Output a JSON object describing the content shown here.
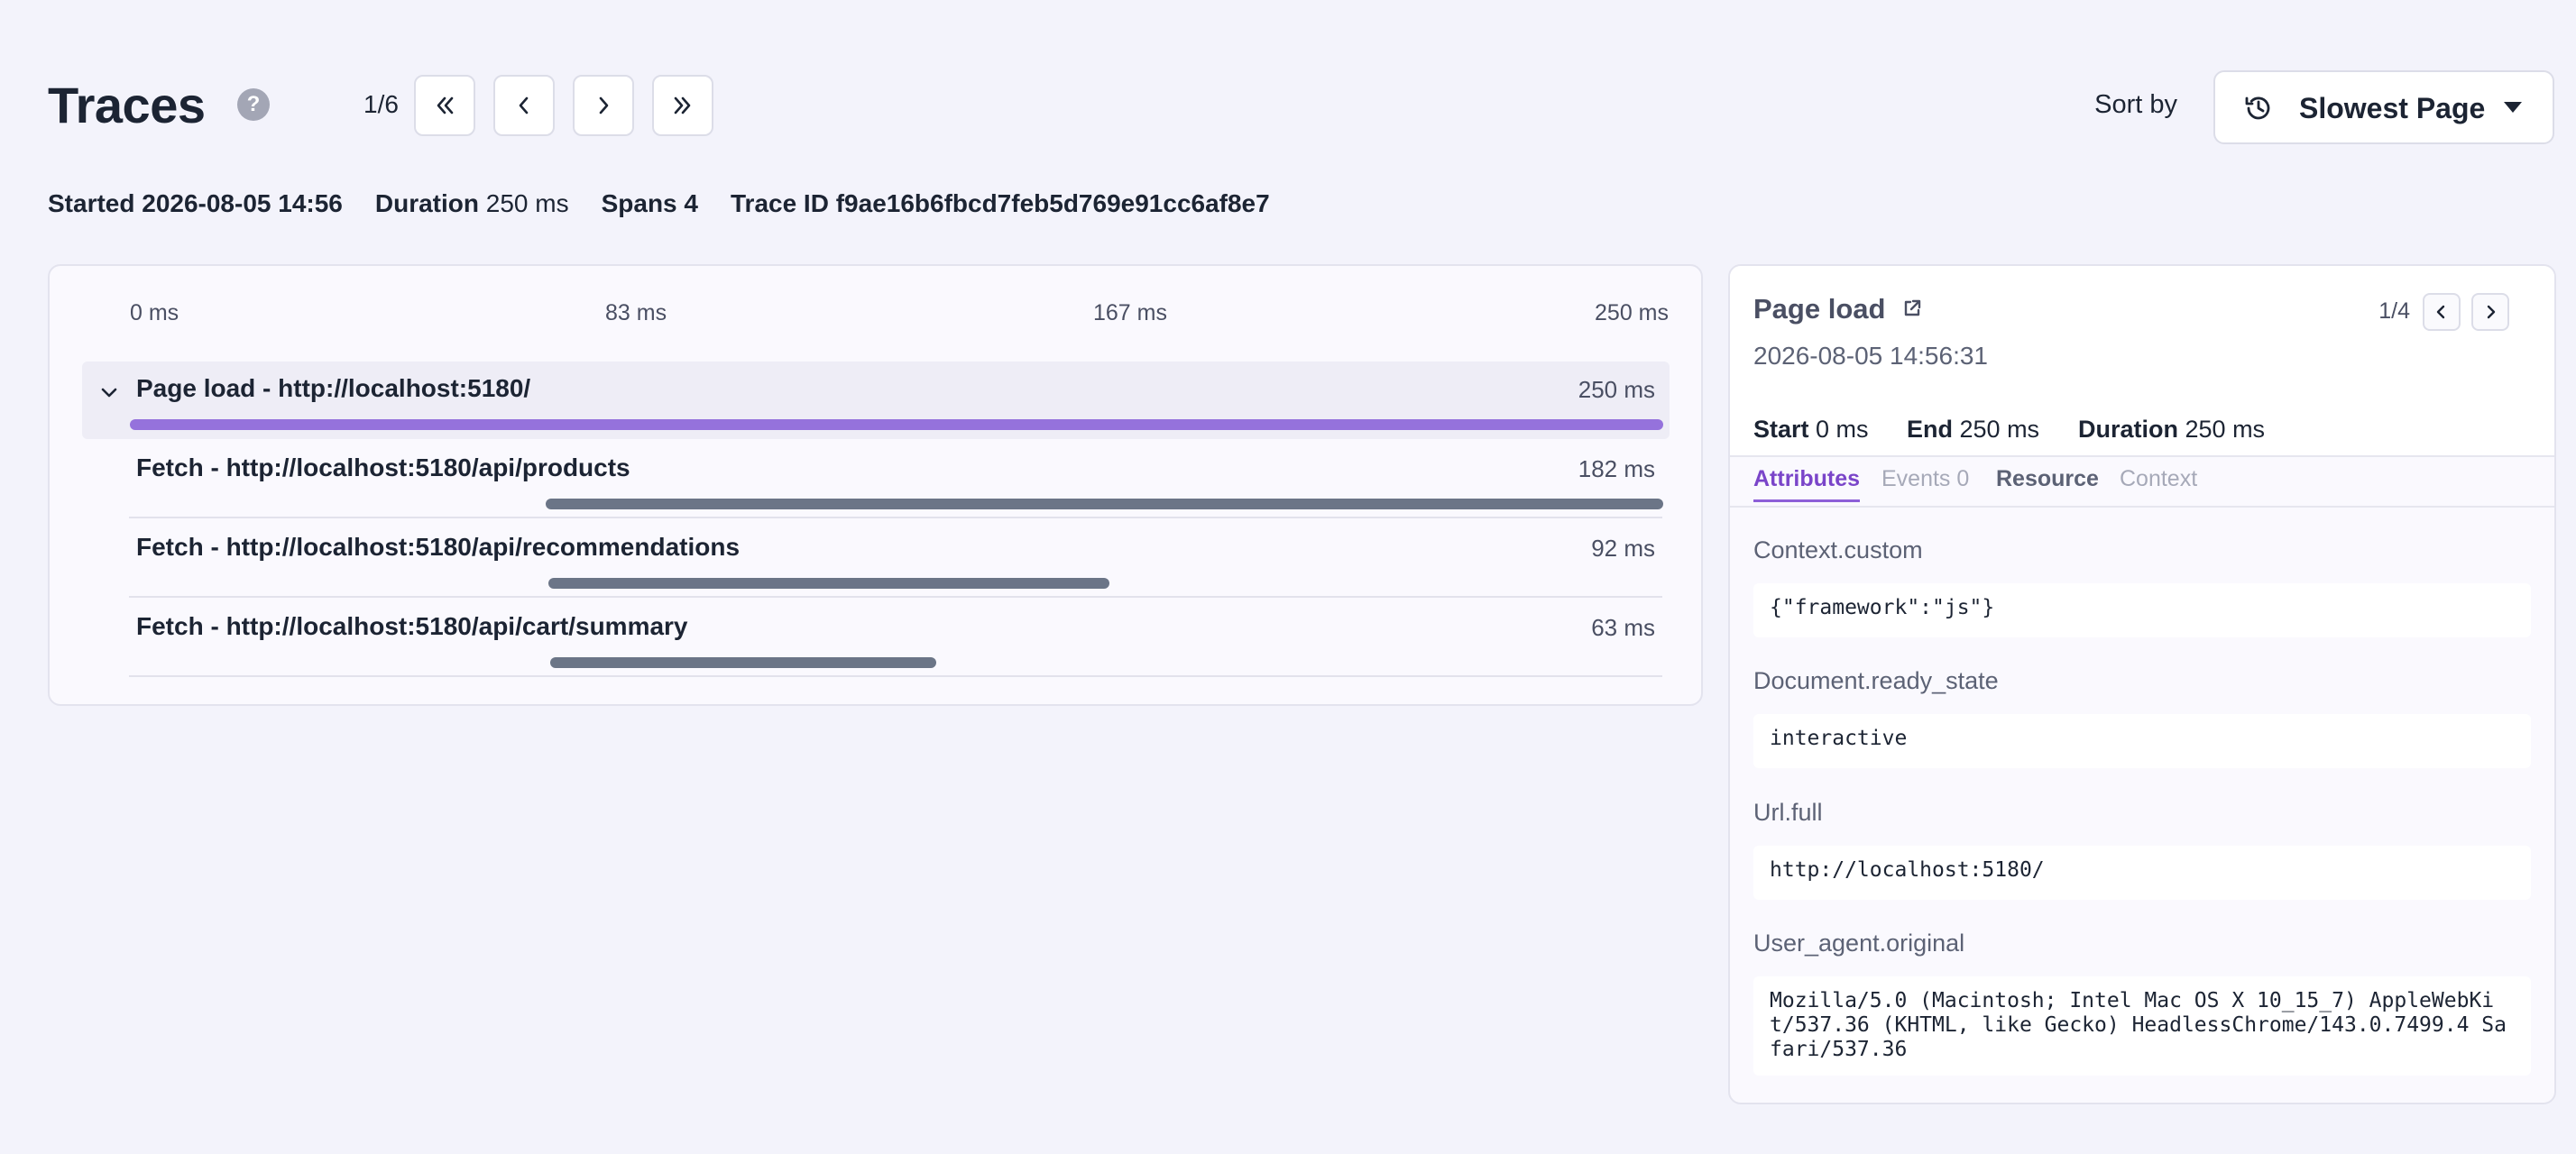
{
  "header": {
    "title": "Traces",
    "help_glyph": "?",
    "pager": "1/6",
    "sort_label": "Sort by",
    "sort_value": "Slowest Page"
  },
  "meta": {
    "started_label": "Started",
    "started_value": "2026-08-05 14:56",
    "duration_label": "Duration",
    "duration_value": "250 ms",
    "spans_label": "Spans",
    "spans_value": "4",
    "traceid_label": "Trace ID",
    "traceid_value": "f9ae16b6fbcd7feb5d769e91cc6af8e7"
  },
  "timeline": {
    "ticks": [
      "0 ms",
      "83 ms",
      "167 ms",
      "250 ms"
    ],
    "total_ms": 250,
    "spans": [
      {
        "kind": "Page load",
        "url": "http://localhost:5180/",
        "duration": "250 ms",
        "start_fraction": 0.0,
        "end_fraction": 1.0,
        "color": "#9572dc",
        "selected": true
      },
      {
        "kind": "Fetch",
        "url": "http://localhost:5180/api/products",
        "duration": "182 ms",
        "start_fraction": 0.271,
        "end_fraction": 1.0,
        "color": "#6b7587",
        "selected": false
      },
      {
        "kind": "Fetch",
        "url": "http://localhost:5180/api/recommendations",
        "duration": "92 ms",
        "start_fraction": 0.273,
        "end_fraction": 0.639,
        "color": "#6b7587",
        "selected": false
      },
      {
        "kind": "Fetch",
        "url": "http://localhost:5180/api/cart/summary",
        "duration": "63 ms",
        "start_fraction": 0.274,
        "end_fraction": 0.526,
        "color": "#6b7587",
        "selected": false
      }
    ]
  },
  "detail": {
    "title": "Page load",
    "timestamp": "2026-08-05 14:56:31",
    "position": "1/4",
    "start_label": "Start",
    "start_value": "0 ms",
    "end_label": "End",
    "end_value": "250 ms",
    "duration_label": "Duration",
    "duration_value": "250 ms",
    "tabs": [
      "Attributes",
      "Events 0",
      "Resource",
      "Context"
    ],
    "attributes": [
      {
        "key": "Context.custom",
        "value": "{\"framework\":\"js\"}"
      },
      {
        "key": "Document.ready_state",
        "value": "interactive"
      },
      {
        "key": "Url.full",
        "value": "http://localhost:5180/"
      },
      {
        "key": "User_agent.original",
        "value": "Mozilla/5.0 (Macintosh; Intel Mac OS X 10_15_7) AppleWebKit/537.36 (KHTML, like Gecko) HeadlessChrome/143.0.7499.4 Safari/537.36"
      }
    ]
  },
  "colors": {
    "accent": "#8d5fd8",
    "span_root": "#9572dc",
    "span_child": "#6b7587"
  }
}
